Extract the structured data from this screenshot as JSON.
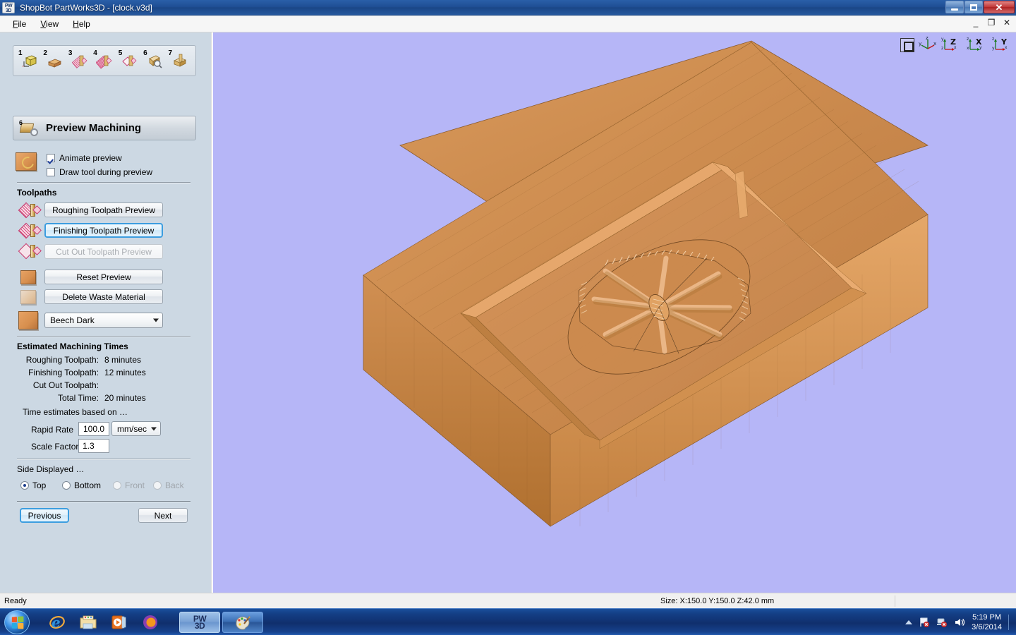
{
  "window": {
    "app_icon": "pw3d-icon",
    "title": "ShopBot PartWorks3D - [clock.v3d]",
    "logo_line1": "PW",
    "logo_line2": "3D",
    "buttons": {
      "minimize": "minimize-button",
      "maximize": "maximize-button",
      "close": "close-button"
    },
    "mdi_buttons": {
      "minimize": "_",
      "restore": "❐",
      "close": "✕"
    }
  },
  "menu": {
    "items": [
      {
        "label": "File",
        "accel": "F"
      },
      {
        "label": "View",
        "accel": "V"
      },
      {
        "label": "Help",
        "accel": "H"
      }
    ]
  },
  "wizard_toolbar": {
    "steps": [
      {
        "num": "1",
        "name": "job-setup"
      },
      {
        "num": "2",
        "name": "import-model"
      },
      {
        "num": "3",
        "name": "roughing-toolpath"
      },
      {
        "num": "4",
        "name": "finishing-toolpath"
      },
      {
        "num": "5",
        "name": "cutout-toolpath"
      },
      {
        "num": "6",
        "name": "preview-machining"
      },
      {
        "num": "7",
        "name": "save-toolpaths"
      }
    ]
  },
  "panel": {
    "step_number": "6",
    "title": "Preview Machining",
    "options": [
      {
        "label": "Animate preview",
        "checked": true
      },
      {
        "label": "Draw tool during preview",
        "checked": false
      }
    ],
    "toolpaths_heading": "Toolpaths",
    "toolpath_buttons": [
      {
        "label": "Roughing Toolpath Preview",
        "state": "normal"
      },
      {
        "label": "Finishing Toolpath Preview",
        "state": "focused"
      },
      {
        "label": "Cut Out Toolpath Preview",
        "state": "disabled"
      }
    ],
    "action_buttons": [
      {
        "label": "Reset Preview"
      },
      {
        "label": "Delete Waste Material"
      }
    ],
    "material": {
      "selected": "Beech Dark"
    },
    "times_heading": "Estimated Machining Times",
    "times": [
      {
        "label": "Roughing Toolpath:",
        "value": "8 minutes"
      },
      {
        "label": "Finishing Toolpath:",
        "value": "12 minutes"
      },
      {
        "label": "Cut Out Toolpath:",
        "value": ""
      },
      {
        "label": "Total Time:",
        "value": "20 minutes"
      }
    ],
    "estimates_note": "Time estimates based on …",
    "rapid_rate": {
      "label": "Rapid Rate",
      "value": "100.0",
      "units": "mm/sec"
    },
    "scale_factor": {
      "label": "Scale Factor",
      "value": "1.3"
    },
    "side_displayed_label": "Side Displayed …",
    "sides": [
      {
        "label": "Top",
        "selected": true,
        "enabled": true
      },
      {
        "label": "Bottom",
        "selected": false,
        "enabled": true
      },
      {
        "label": "Front",
        "selected": false,
        "enabled": false
      },
      {
        "label": "Back",
        "selected": false,
        "enabled": false
      }
    ],
    "nav": {
      "previous": "Previous",
      "next": "Next"
    }
  },
  "viewport": {
    "background_color": "#b6b6f7",
    "axis_views": [
      {
        "name": "iso-view",
        "label": ""
      },
      {
        "name": "z-view",
        "label": "Z"
      },
      {
        "name": "x-view",
        "label": "X"
      },
      {
        "name": "y-view",
        "label": "Y"
      }
    ],
    "axis_labels": {
      "x": "x",
      "y": "y",
      "z": "z"
    }
  },
  "statusbar": {
    "message": "Ready",
    "size": "Size: X:150.0 Y:150.0 Z:42.0 mm"
  },
  "taskbar": {
    "start": "start-orb",
    "quick_launch": [
      {
        "name": "internet-explorer-icon"
      },
      {
        "name": "windows-explorer-icon"
      },
      {
        "name": "windows-media-player-icon"
      },
      {
        "name": "firefox-icon"
      }
    ],
    "tasks": [
      {
        "name": "partworks3d-task",
        "line1": "PW",
        "line2": "3D",
        "active": true
      },
      {
        "name": "paint-task",
        "active": false
      }
    ],
    "tray": {
      "show_hidden": "show-hidden-icons-arrow",
      "icons": [
        "action-center-flag-icon",
        "network-icon",
        "volume-icon"
      ],
      "time": "5:19 PM",
      "date": "3/6/2014"
    }
  },
  "colors": {
    "accent_blue": "#3c9ddf",
    "sidebar_bg": "#ccd8e3",
    "viewport_bg": "#b6b6f7",
    "wood_light": "#e6a264",
    "wood_dark": "#b9743b",
    "titlebar": "#1f4f95"
  }
}
